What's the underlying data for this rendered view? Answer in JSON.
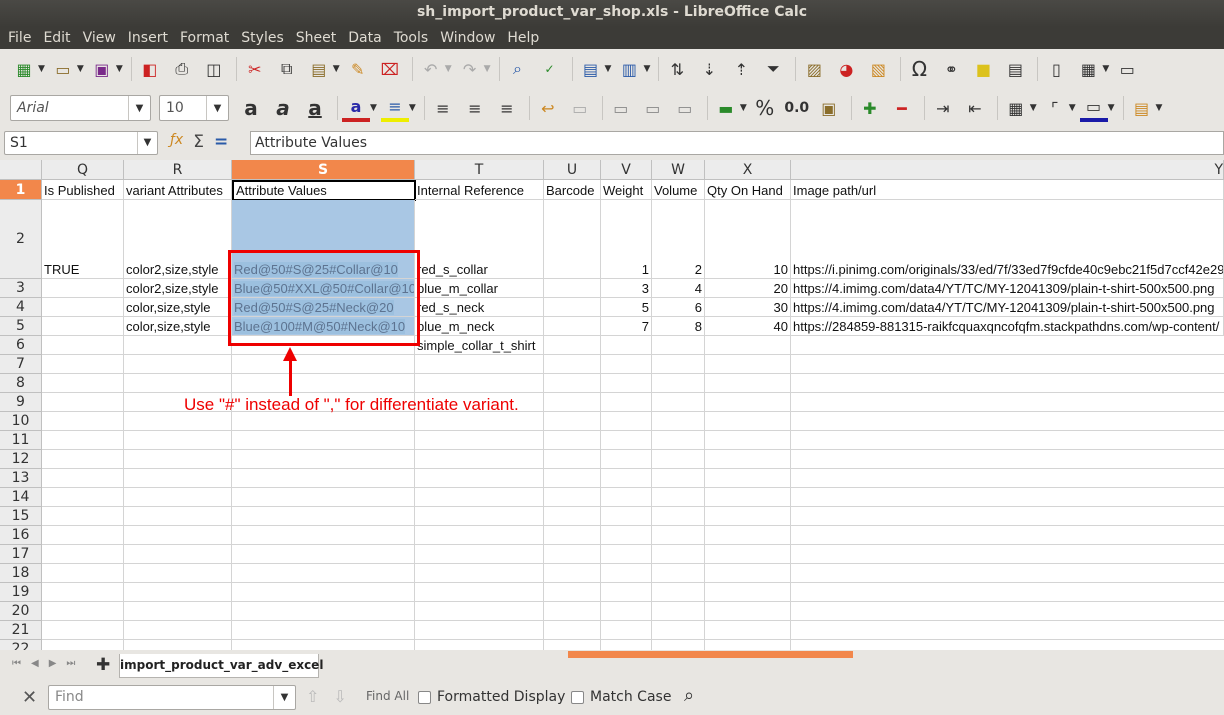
{
  "window": {
    "title": "sh_import_product_var_shop.xls - LibreOffice Calc"
  },
  "menu": [
    "File",
    "Edit",
    "View",
    "Insert",
    "Format",
    "Styles",
    "Sheet",
    "Data",
    "Tools",
    "Window",
    "Help"
  ],
  "toolbar": {
    "font_name": "Arial",
    "font_size": "10",
    "percent_label": "%",
    "decimal_label": "0.0"
  },
  "formula_bar": {
    "cell_ref": "S1",
    "content": "Attribute Values"
  },
  "columns": [
    "Q",
    "R",
    "S",
    "T",
    "U",
    "V",
    "W",
    "X",
    "Y"
  ],
  "active_column": "S",
  "rows": [
    "1",
    "2",
    "3",
    "4",
    "5",
    "6",
    "7",
    "8",
    "9",
    "10",
    "11",
    "12",
    "13",
    "14",
    "15",
    "16",
    "17",
    "18",
    "19",
    "20",
    "21",
    "22"
  ],
  "header_row": [
    "Is Published",
    "variant Attributes",
    "Attribute Values",
    "Internal Reference",
    "Barcode",
    "Weight",
    "Volume",
    "Qty On Hand",
    "Image path/url"
  ],
  "data_rows": [
    {
      "is_published": "TRUE",
      "variant_attributes": "color2,size,style",
      "attribute_values": "Red@50#S@25#Collar@10",
      "internal_reference": "red_s_collar",
      "weight": "1",
      "volume": "2",
      "qty": "10",
      "image": "https://i.pinimg.com/originals/33/ed/7f/33ed7f9cfde40c9ebc21f5d7ccf42e29"
    },
    {
      "is_published": "",
      "variant_attributes": "color2,size,style",
      "attribute_values": "Blue@50#XXL@50#Collar@10",
      "internal_reference": "blue_m_collar",
      "weight": "3",
      "volume": "4",
      "qty": "20",
      "image": "https://4.imimg.com/data4/YT/TC/MY-12041309/plain-t-shirt-500x500.png"
    },
    {
      "is_published": "",
      "variant_attributes": "color,size,style",
      "attribute_values": "Red@50#S@25#Neck@20",
      "internal_reference": "red_s_neck",
      "weight": "5",
      "volume": "6",
      "qty": "30",
      "image": "https://4.imimg.com/data4/YT/TC/MY-12041309/plain-t-shirt-500x500.png"
    },
    {
      "is_published": "",
      "variant_attributes": "color,size,style",
      "attribute_values": "Blue@100#M@50#Neck@10",
      "internal_reference": "blue_m_neck",
      "weight": "7",
      "volume": "8",
      "qty": "40",
      "image": "https://284859-881315-raikfcquaxqncofqfm.stackpathdns.com/wp-content/"
    }
  ],
  "row6_internal_reference": "simple_collar_t_shirt",
  "annotation": "Use \"#\" instead of \",\" for differentiate variant.",
  "annotation_color": "#e00000",
  "sheet_tab": "import_product_var_adv_excel",
  "findbar": {
    "placeholder": "Find",
    "find_all": "Find All",
    "formatted_display": "Formatted Display",
    "match_case": "Match Case"
  },
  "accent_color": "#f2874b"
}
